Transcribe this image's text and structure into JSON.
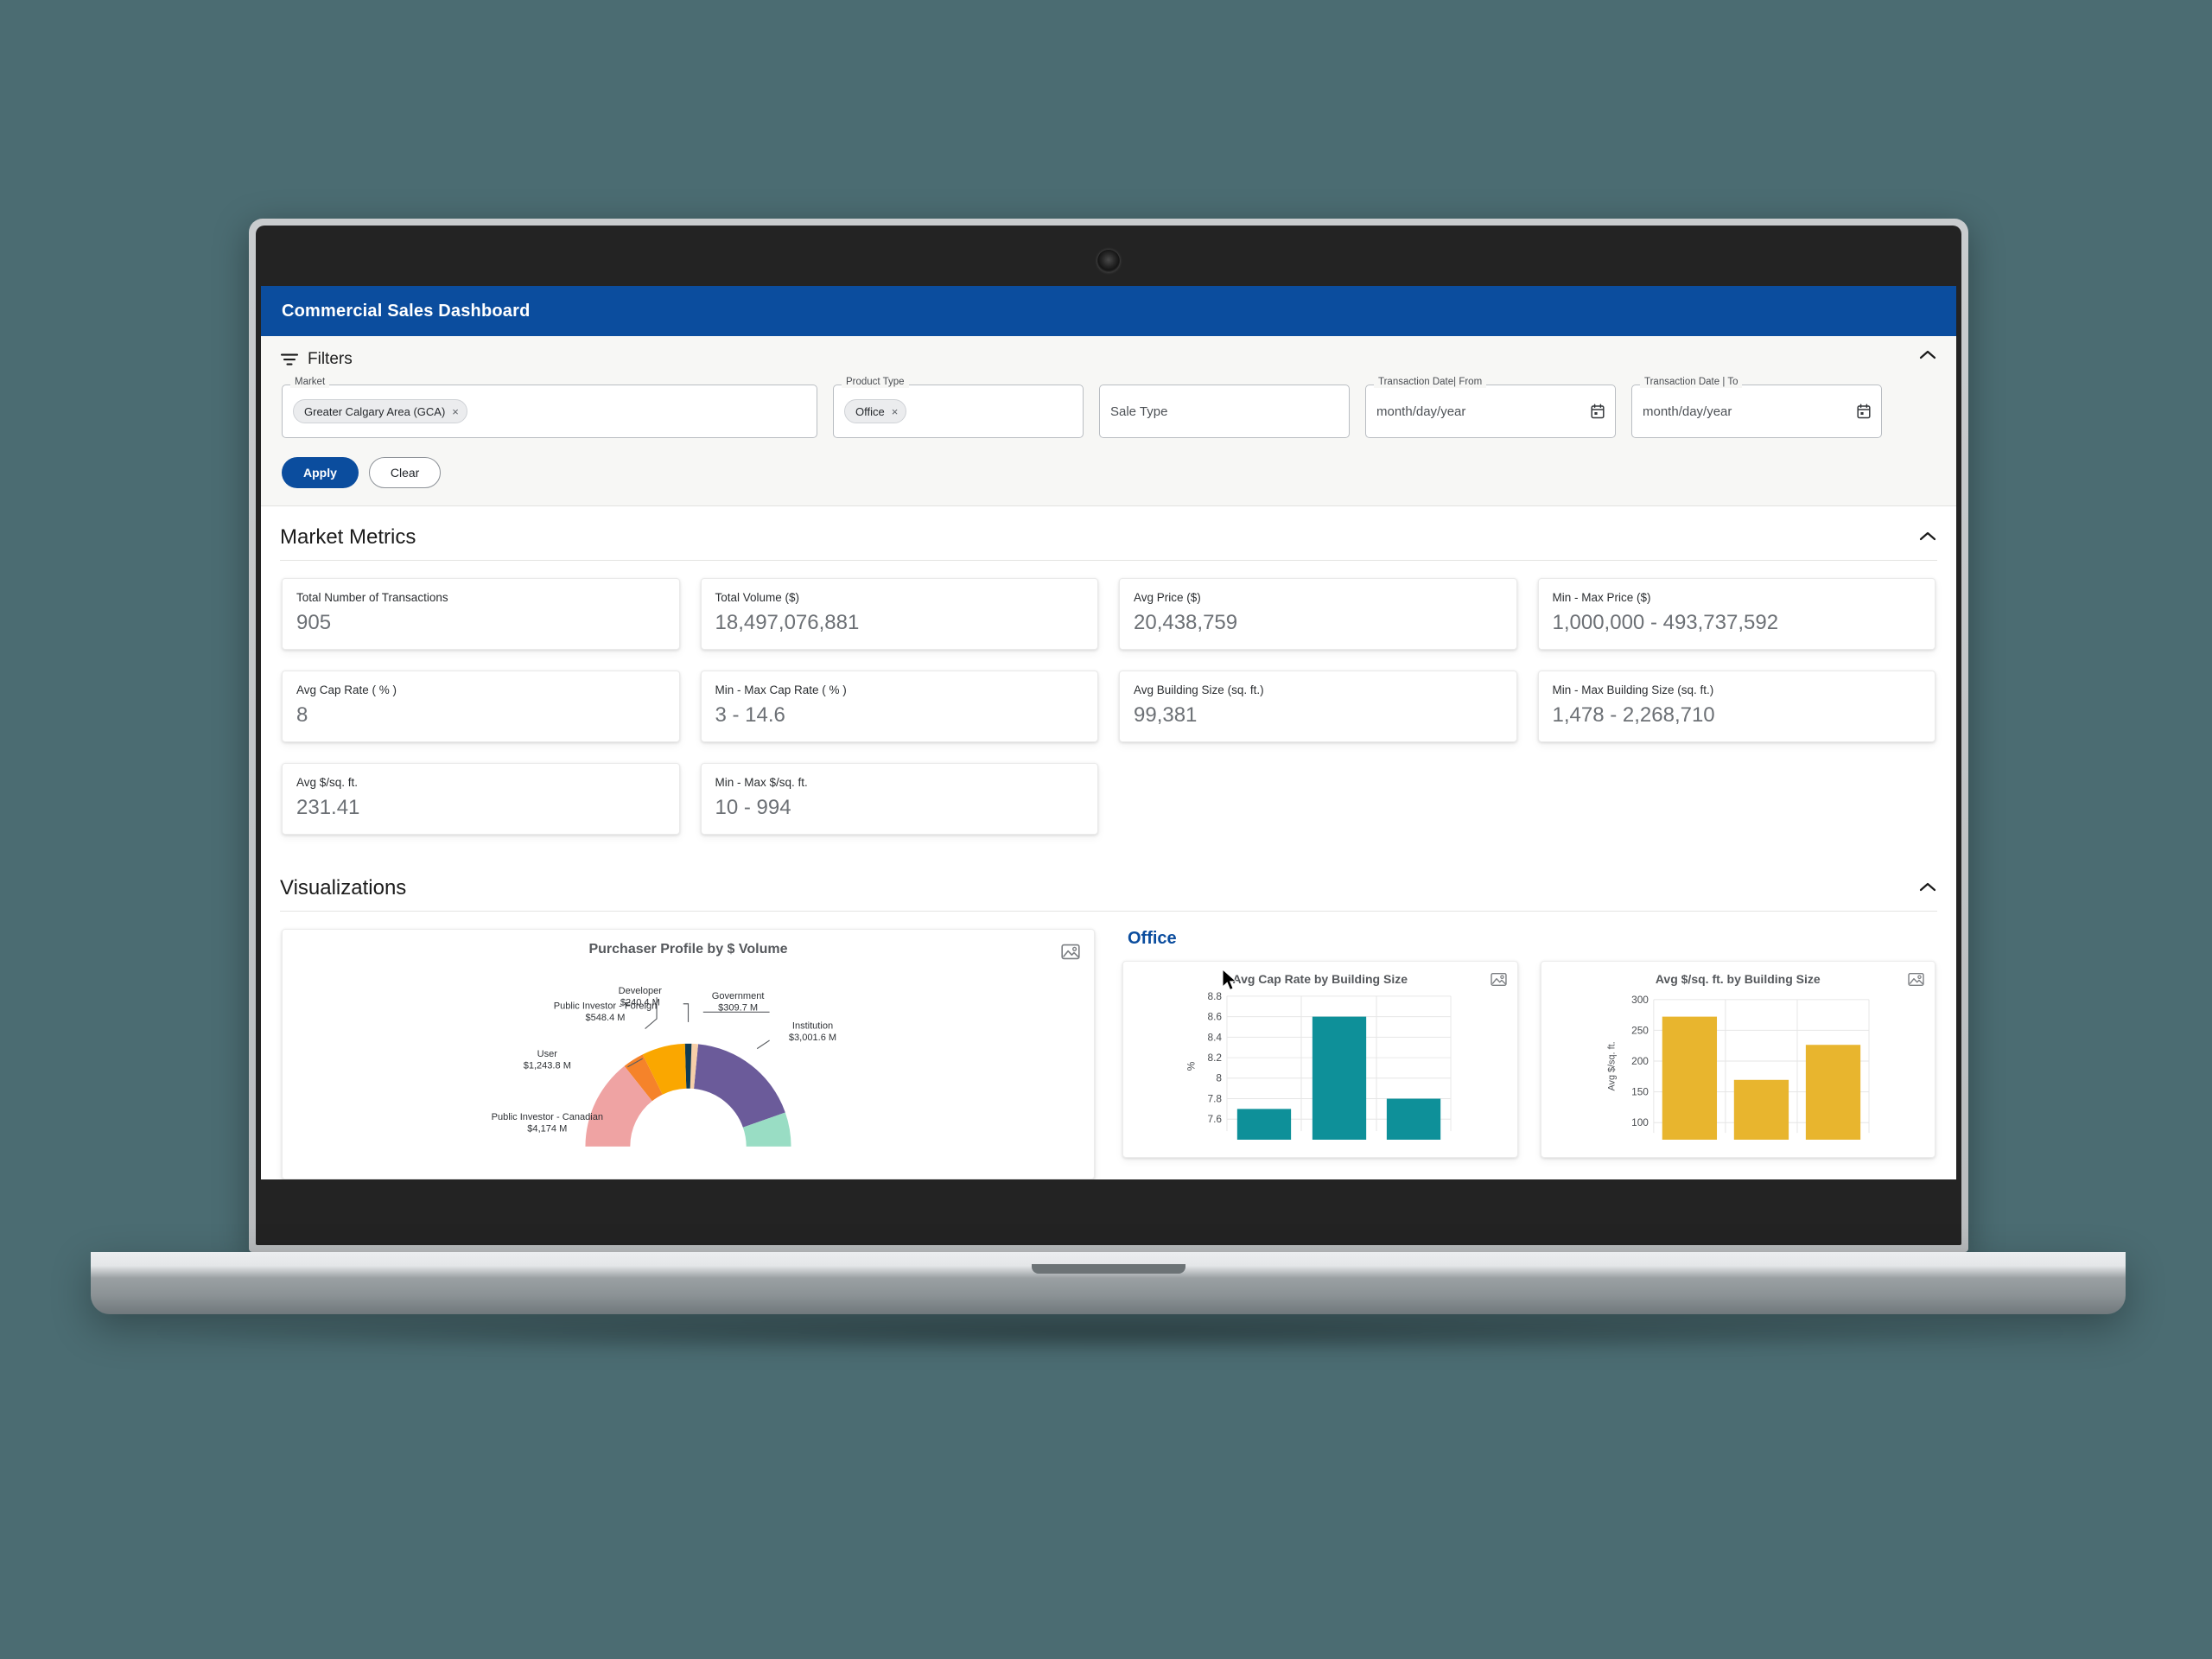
{
  "app": {
    "title": "Commercial Sales Dashboard",
    "brand_color": "#0b4d9e"
  },
  "filters": {
    "label": "Filters",
    "icon": "filter-icon",
    "collapse_icon": "chevron-up-icon",
    "fields": [
      {
        "label": "Market",
        "chip": "Greater Calgary Area (GCA)",
        "chip_remove": "×"
      },
      {
        "label": "Product Type",
        "chip": "Office",
        "chip_remove": "×"
      },
      {
        "label": "",
        "placeholder": "Sale Type"
      },
      {
        "label": "Transaction Date| From",
        "placeholder": "month/day/year",
        "icon": "calendar-icon"
      },
      {
        "label": "Transaction Date | To",
        "placeholder": "month/day/year",
        "icon": "calendar-icon"
      }
    ],
    "apply_label": "Apply",
    "clear_label": "Clear"
  },
  "market_metrics": {
    "title": "Market Metrics",
    "collapse_icon": "chevron-up-icon",
    "cards": [
      {
        "label": "Total Number of Transactions",
        "value": "905"
      },
      {
        "label": "Total Volume ($)",
        "value": "18,497,076,881"
      },
      {
        "label": "Avg Price ($)",
        "value": "20,438,759"
      },
      {
        "label": "Min - Max Price ($)",
        "value": "1,000,000 - 493,737,592"
      },
      {
        "label": "Avg Cap Rate ( % )",
        "value": "8"
      },
      {
        "label": "Min - Max Cap Rate ( % )",
        "value": "3 - 14.6"
      },
      {
        "label": "Avg Building Size (sq. ft.)",
        "value": "99,381"
      },
      {
        "label": "Min - Max Building Size (sq. ft.)",
        "value": "1,478 - 2,268,710"
      },
      {
        "label": "Avg $/sq. ft.",
        "value": "231.41"
      },
      {
        "label": "Min - Max $/sq. ft.",
        "value": "10 - 994"
      }
    ]
  },
  "visualizations": {
    "title": "Visualizations",
    "collapse_icon": "chevron-up-icon",
    "office_group_label": "Office",
    "export_icon": "image-export-icon"
  },
  "chart_data": [
    {
      "type": "pie",
      "title": "Purchaser Profile by $ Volume",
      "xlabel": "",
      "ylabel": "",
      "legend_position": "callout-labels",
      "grid": false,
      "categories": [
        "Institution",
        "Public Investor - Canadian",
        "User",
        "Public Investor - Foreign",
        "Developer",
        "Government"
      ],
      "values": [
        3001.6,
        4174,
        1243.8,
        548.4,
        240.4,
        309.7
      ],
      "value_labels": [
        "$3,001.6 M",
        "$4,174 M",
        "$1,243.8 M",
        "$548.4 M",
        "$240.4 M",
        "$309.7 M"
      ],
      "colors": [
        "#6b5b9a",
        "#efa3a3",
        "#faa700",
        "#f5832a",
        "#0f3b52",
        "#f6cfa8"
      ],
      "extra_slice_color": "#99ddc4"
    },
    {
      "type": "bar",
      "title": "Avg Cap Rate by Building Size",
      "xlabel": "",
      "ylabel": "%",
      "categories": [
        "",
        "",
        ""
      ],
      "values": [
        7.7,
        8.6,
        7.8
      ],
      "ylim": [
        7.6,
        8.8
      ],
      "yticks": [
        "8.8",
        "8.6",
        "8.4",
        "8.2",
        "8",
        "7.8",
        "7.6"
      ],
      "grid": true,
      "color": "#0e9099"
    },
    {
      "type": "bar",
      "title": "Avg $/sq. ft. by Building Size",
      "xlabel": "",
      "ylabel": "Avg $/sq. ft.",
      "categories": [
        "",
        "",
        ""
      ],
      "values": [
        272,
        170,
        227
      ],
      "ylim": [
        50,
        300
      ],
      "yticks": [
        "300",
        "250",
        "200",
        "150",
        "100"
      ],
      "grid": true,
      "color": "#e8b52e"
    }
  ]
}
